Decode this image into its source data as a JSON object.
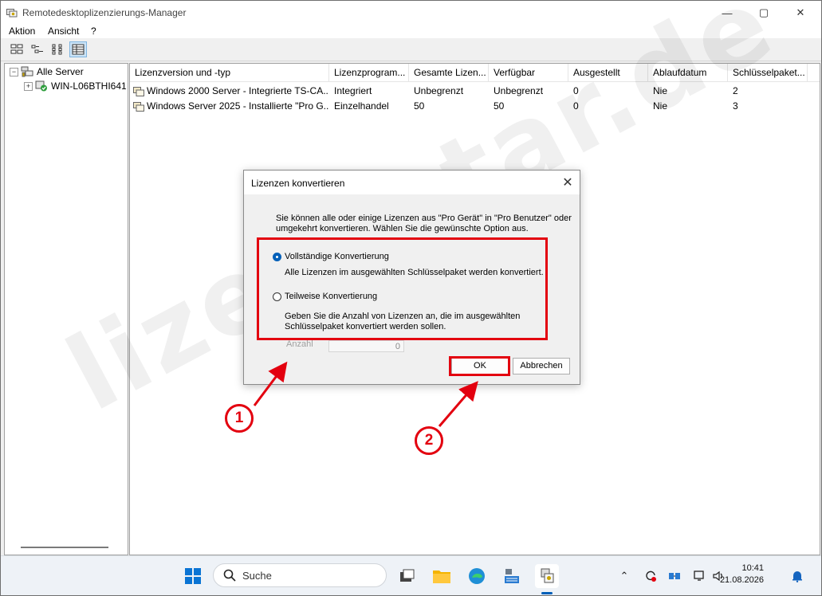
{
  "window": {
    "title": "Remotedesktoplizenzierungs-Manager",
    "controls": {
      "minimize": "—",
      "maximize": "▢",
      "close": "✕"
    }
  },
  "menu": {
    "items": [
      "Aktion",
      "Ansicht",
      "?"
    ]
  },
  "tree": {
    "root": "Alle Server",
    "server": "WIN-L06BTHI641"
  },
  "list": {
    "columns": [
      "Lizenzversion und -typ",
      "Lizenzprogram...",
      "Gesamte Lizen...",
      "Verfügbar",
      "Ausgestellt",
      "Ablaufdatum",
      "Schlüsselpaket..."
    ],
    "rows": [
      [
        "Windows 2000 Server - Integrierte TS-CA...",
        "Integriert",
        "Unbegrenzt",
        "Unbegrenzt",
        "0",
        "Nie",
        "2"
      ],
      [
        "Windows Server 2025 - Installierte \"Pro G...",
        "Einzelhandel",
        "50",
        "50",
        "0",
        "Nie",
        "3"
      ]
    ]
  },
  "dialog": {
    "title": "Lizenzen konvertieren",
    "intro_line1": "Sie können alle oder einige Lizenzen aus \"Pro Gerät\" in \"Pro Benutzer\" oder",
    "intro_line2": "umgekehrt konvertieren. Wählen Sie die gewünschte Option aus.",
    "option_full": "Vollständige Konvertierung",
    "option_full_desc": "Alle Lizenzen im ausgewählten Schlüsselpaket werden konvertiert.",
    "option_partial": "Teilweise Konvertierung",
    "option_partial_desc_line1": "Geben Sie die Anzahl von Lizenzen an, die im ausgewählten",
    "option_partial_desc_line2": "Schlüsselpaket konvertiert werden sollen.",
    "count_label": "Anzahl",
    "count_value": "0",
    "ok": "OK",
    "cancel": "Abbrechen",
    "selected_option": "full"
  },
  "annotations": {
    "marker1": "1",
    "marker2": "2",
    "color": "#e3000f"
  },
  "watermark": "lizenzstar.de",
  "taskbar": {
    "search_placeholder": "Suche",
    "time": "10:41",
    "date": "21.08.2026"
  },
  "colors": {
    "accent": "#005fb8",
    "annotation": "#e3000f"
  }
}
